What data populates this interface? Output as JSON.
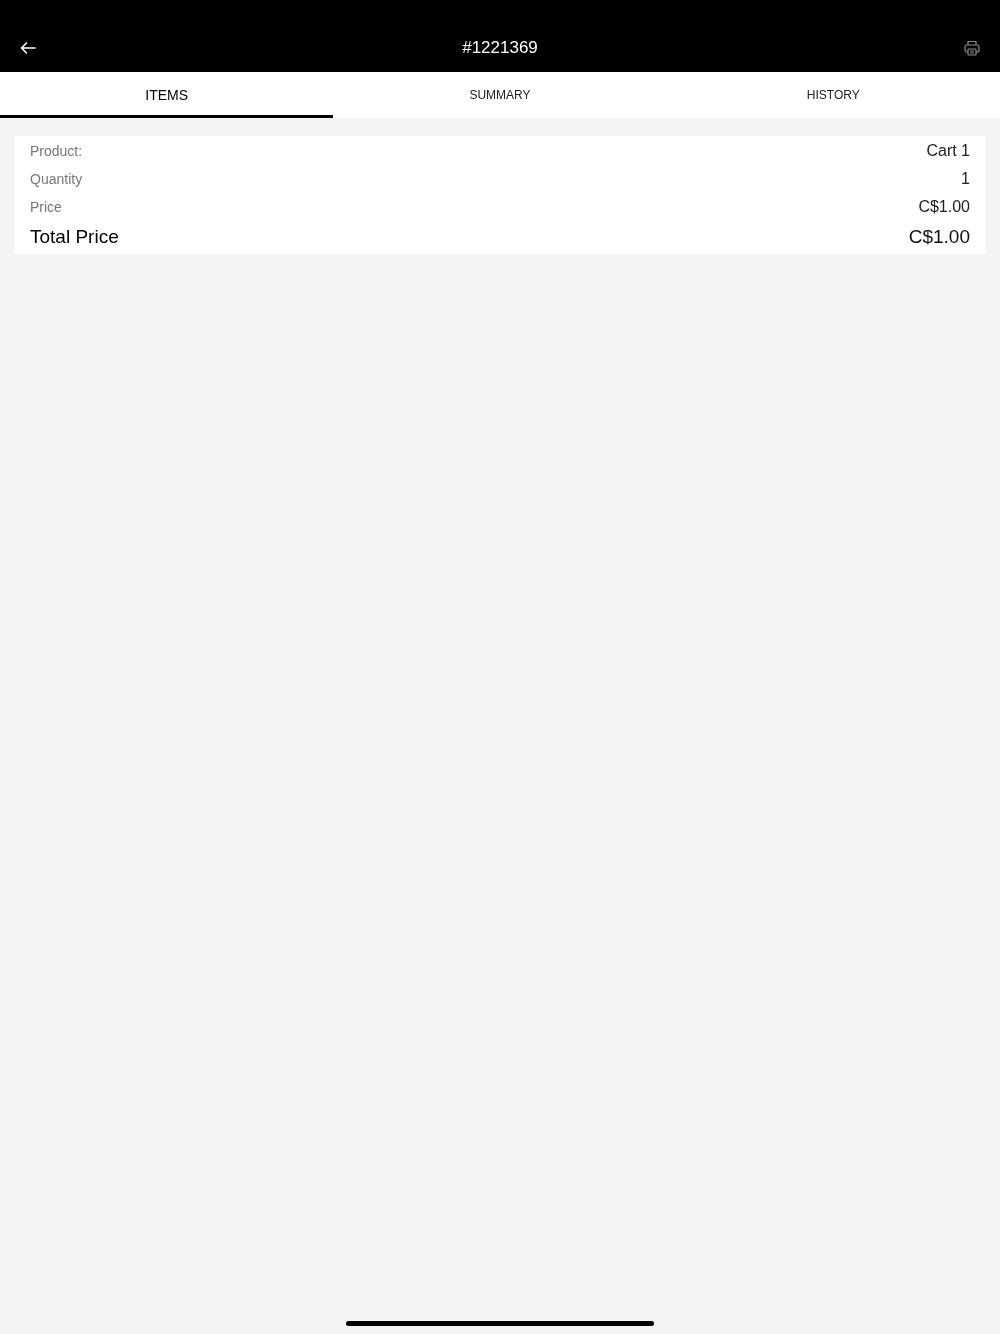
{
  "header": {
    "title": "#1221369"
  },
  "tabs": [
    {
      "label": "ITEMS",
      "selected": true
    },
    {
      "label": "SUMMARY",
      "selected": false
    },
    {
      "label": "HISTORY",
      "selected": false
    }
  ],
  "details": [
    {
      "kind": "line",
      "label": "Product:",
      "value": "Cart 1"
    },
    {
      "kind": "line",
      "label": "Quantity",
      "value": "1"
    },
    {
      "kind": "line",
      "label": "Price",
      "value": "C$1.00"
    },
    {
      "kind": "total",
      "label": "Total Price",
      "value": "C$1.00"
    }
  ]
}
